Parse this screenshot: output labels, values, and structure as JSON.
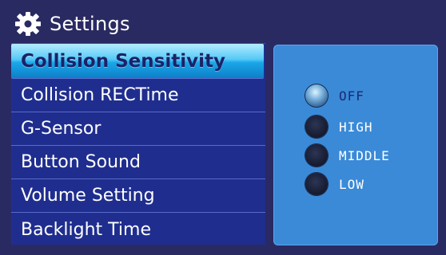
{
  "header": {
    "title": "Settings",
    "icon": "gear-icon"
  },
  "menu": {
    "items": [
      {
        "label": "Collision Sensitivity",
        "selected": true
      },
      {
        "label": "Collision RECTime",
        "selected": false
      },
      {
        "label": "G-Sensor",
        "selected": false
      },
      {
        "label": "Button Sound",
        "selected": false
      },
      {
        "label": "Volume Setting",
        "selected": false
      },
      {
        "label": "Backlight Time",
        "selected": false
      }
    ]
  },
  "options": {
    "items": [
      {
        "label": "OFF",
        "checked": true
      },
      {
        "label": "HIGH",
        "checked": false
      },
      {
        "label": "MIDDLE",
        "checked": false
      },
      {
        "label": "LOW",
        "checked": false
      }
    ]
  },
  "colors": {
    "background": "#2a2a62",
    "menu": "#1f2e8e",
    "highlight": "#39b8f0",
    "panel": "#3a8ad8"
  }
}
